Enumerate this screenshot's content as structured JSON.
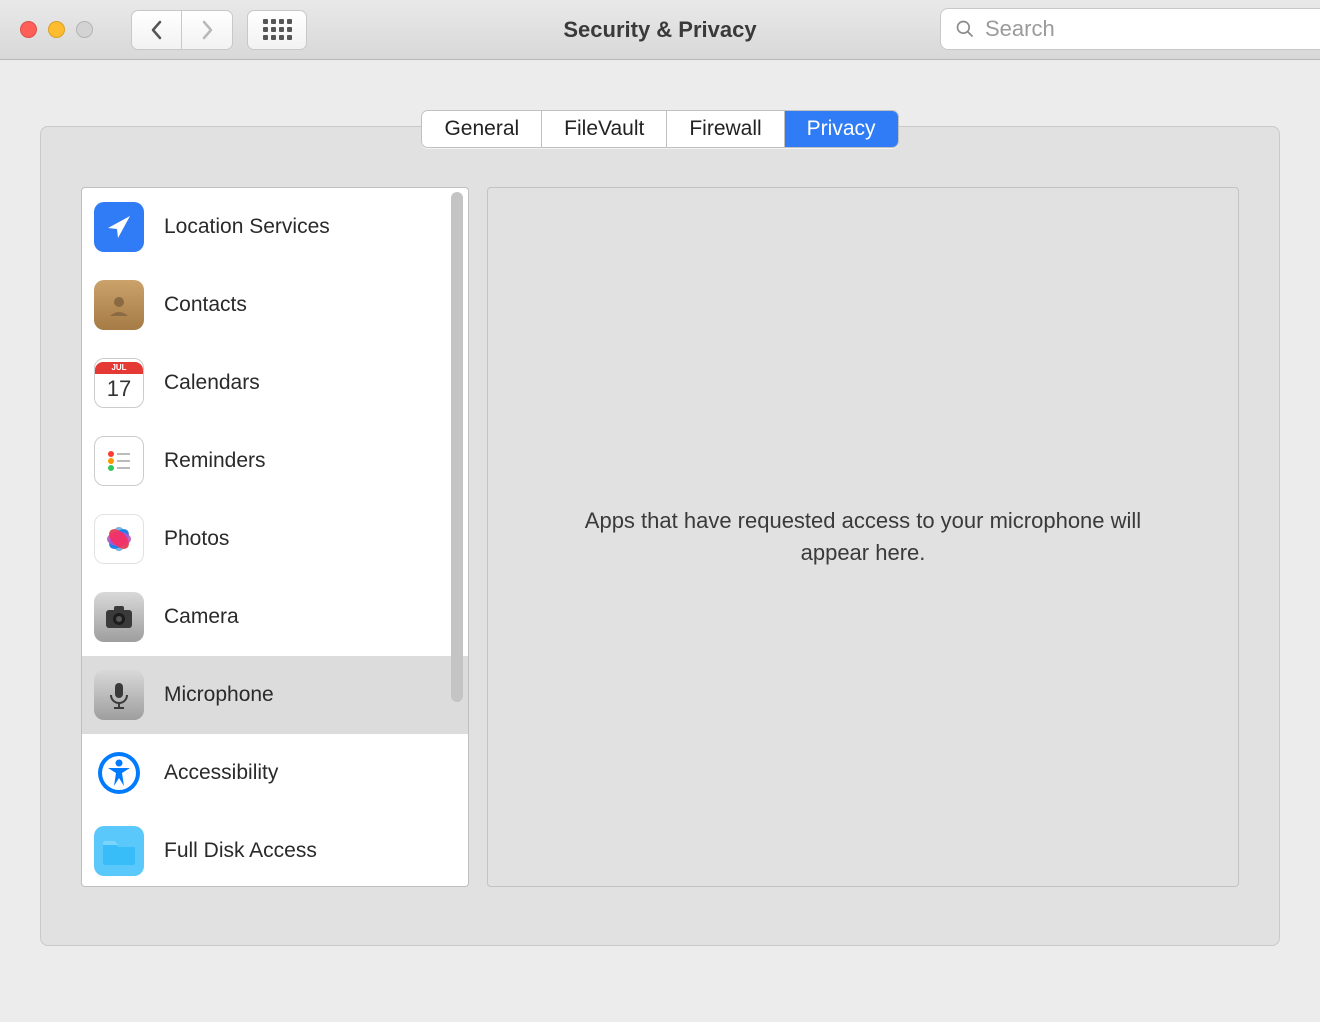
{
  "window": {
    "title": "Security & Privacy"
  },
  "search": {
    "placeholder": "Search",
    "value": ""
  },
  "tabs": [
    {
      "label": "General",
      "active": false
    },
    {
      "label": "FileVault",
      "active": false
    },
    {
      "label": "Firewall",
      "active": false
    },
    {
      "label": "Privacy",
      "active": true
    }
  ],
  "sidebar": {
    "selected_index": 6,
    "items": [
      {
        "label": "Location Services",
        "icon": "location-arrow-icon"
      },
      {
        "label": "Contacts",
        "icon": "contacts-book-icon"
      },
      {
        "label": "Calendars",
        "icon": "calendar-icon",
        "badge_top": "JUL",
        "badge_main": "17"
      },
      {
        "label": "Reminders",
        "icon": "reminders-list-icon"
      },
      {
        "label": "Photos",
        "icon": "photos-flower-icon"
      },
      {
        "label": "Camera",
        "icon": "camera-icon"
      },
      {
        "label": "Microphone",
        "icon": "microphone-icon"
      },
      {
        "label": "Accessibility",
        "icon": "accessibility-icon"
      },
      {
        "label": "Full Disk Access",
        "icon": "folder-icon"
      }
    ]
  },
  "detail": {
    "empty_message": "Apps that have requested access to your microphone will appear here."
  },
  "colors": {
    "accent": "#2f7cf6"
  }
}
